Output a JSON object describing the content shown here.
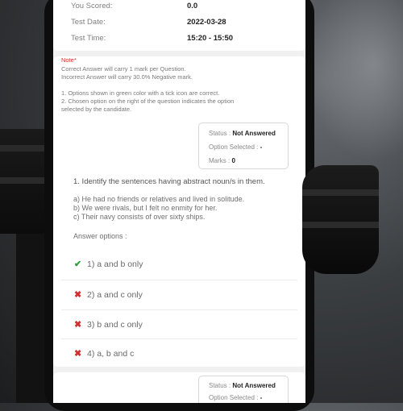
{
  "summary": {
    "scored_label": "You Scored:",
    "scored_value": "0.0",
    "date_label": "Test Date:",
    "date_value": "2022-03-28",
    "time_label": "Test Time:",
    "time_value": "15:20 - 15:50"
  },
  "note": {
    "title": "Note*",
    "lines": [
      "Correct Answer will carry 1 mark per Question.",
      "Incorrect Answer will carry 30.0% Negative mark.",
      "1. Options shown in green color with a tick icon are correct.",
      "2. Chosen option on the right of the question indicates the option",
      "selected by the candidate."
    ]
  },
  "question1": {
    "status_label": "Status :",
    "status_value": "Not Answered",
    "option_selected_label": "Option Selected :",
    "option_selected_value": "-",
    "marks_label": "Marks :",
    "marks_value": "0",
    "text": "1. Identify the sentences having abstract noun/s in them.",
    "sentences": [
      "a) He had no friends or relatives and lived in solitude.",
      "b) We were rivals, but I felt no enmity for her.",
      "c) Their navy consists of over sixty ships."
    ],
    "answer_options_label": "Answer options :",
    "options": [
      {
        "label": "1) a and b only",
        "correct": true
      },
      {
        "label": "2) a and c only",
        "correct": false
      },
      {
        "label": "3) b and c only",
        "correct": false
      },
      {
        "label": "4) a, b and c",
        "correct": false
      }
    ]
  },
  "question2": {
    "status_label": "Status :",
    "status_value": "Not Answered",
    "option_selected_label": "Option Selected :",
    "option_selected_value": "-"
  },
  "colors": {
    "correct": "#2e9e3a",
    "incorrect": "#d32f2f",
    "note": "#d32f2f"
  },
  "icons": {
    "correct": "check-icon",
    "incorrect": "cross-icon"
  }
}
